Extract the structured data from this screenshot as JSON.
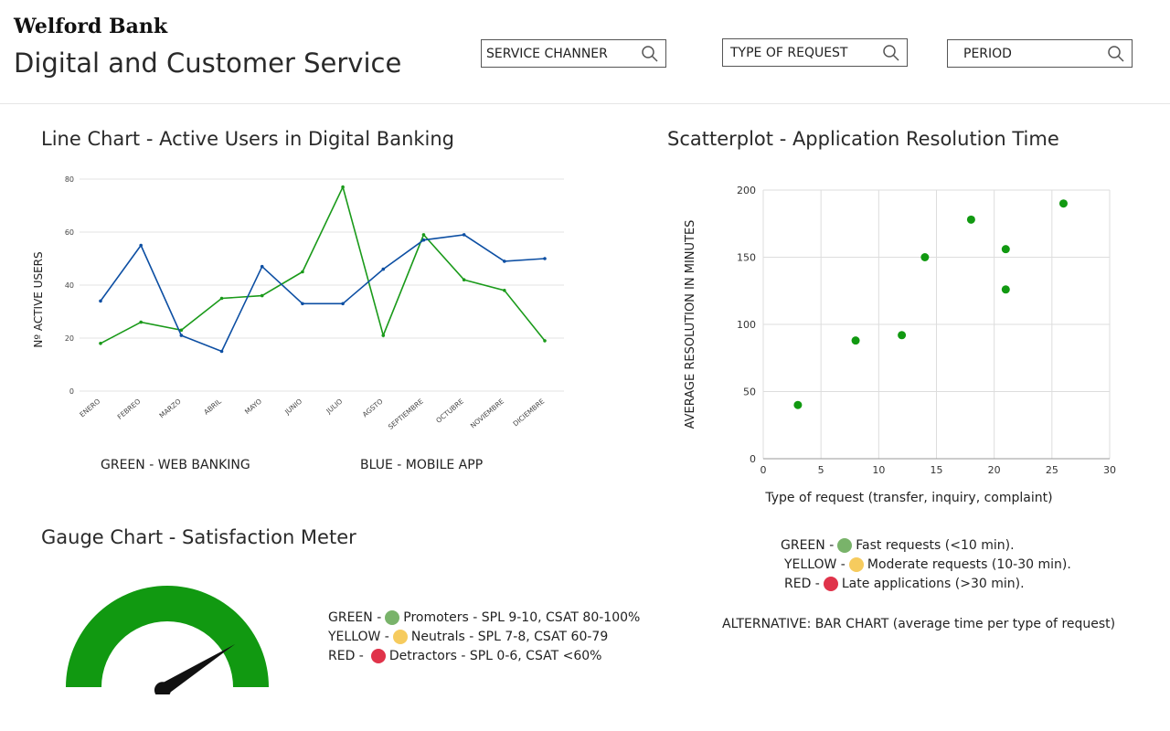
{
  "header": {
    "brand": "Welford Bank",
    "title": "Digital and Customer Service",
    "filters": [
      {
        "label": "SERVICE CHANNER",
        "icon": "search-icon"
      },
      {
        "label": "TYPE OF REQUEST",
        "icon": "search-icon"
      },
      {
        "label": "PERIOD",
        "icon": "search-icon"
      }
    ]
  },
  "line_section": {
    "title": "Line Chart - Active Users in Digital Banking",
    "legend_green": "GREEN - WEB BANKING",
    "legend_blue": "BLUE - MOBILE APP"
  },
  "scatter_section": {
    "title": "Scatterplot - Application Resolution Time",
    "legend": [
      {
        "prefix": "GREEN - ",
        "text": "Fast requests (<10 min).",
        "color": "#79b36a"
      },
      {
        "prefix": "YELLOW - ",
        "text": "Moderate requests (10-30 min).",
        "color": "#f6cb5e"
      },
      {
        "prefix": "RED - ",
        "text": "Late applications (>30 min).",
        "color": "#e0334a"
      }
    ],
    "alternative_note": "ALTERNATIVE: BAR CHART (average time per type of request)"
  },
  "gauge_section": {
    "title": "Gauge Chart - Satisfaction Meter",
    "legend": [
      {
        "prefix": "GREEN - ",
        "text": "Promoters - SPL 9-10, CSAT 80-100%",
        "color": "#79b36a"
      },
      {
        "prefix": "YELLOW - ",
        "text": "Neutrals - SPL 7-8, CSAT 60-79",
        "color": "#f6cb5e"
      },
      {
        "prefix": "RED - ",
        "text": "Detractors - SPL 0-6, CSAT <60%",
        "color": "#e0334a"
      }
    ]
  },
  "colors": {
    "web_banking": "#1a9a1a",
    "mobile_app": "#0d4fa3",
    "scatter_point": "#119911",
    "gauge_fill": "#119911",
    "needle": "#111111"
  },
  "chart_data": [
    {
      "type": "line",
      "categories": [
        "ENERO",
        "FEBREO",
        "MARZO",
        "ABRIL",
        "MAYO",
        "JUNIO",
        "JULIO",
        "AGSTO",
        "SEPTIEMBRE",
        "OCTUBRE",
        "NOVIEMBRE",
        "DICIEMBRE"
      ],
      "series": [
        {
          "name": "WEB BANKING",
          "color": "#1a9a1a",
          "values": [
            18,
            26,
            23,
            35,
            36,
            45,
            77,
            21,
            59,
            42,
            38,
            19
          ]
        },
        {
          "name": "MOBILE APP",
          "color": "#0d4fa3",
          "values": [
            34,
            55,
            21,
            15,
            47,
            33,
            33,
            46,
            57,
            59,
            49,
            50
          ]
        }
      ],
      "ylabel": "Nº ACTIVE USERS",
      "ylim": [
        0,
        80
      ],
      "yticks": [
        0,
        20,
        40,
        60,
        80
      ],
      "grid": true
    },
    {
      "type": "scatter",
      "x": [
        3,
        8,
        12,
        14,
        18,
        21,
        21,
        26
      ],
      "y": [
        40,
        88,
        92,
        150,
        178,
        156,
        126,
        190
      ],
      "xlabel": "Type of request (transfer, inquiry, complaint)",
      "ylabel": "AVERAGE RESOLUTION IN MINUTES",
      "xlim": [
        0,
        30
      ],
      "ylim": [
        0,
        200
      ],
      "xticks": [
        0,
        5,
        10,
        15,
        20,
        25,
        30
      ],
      "yticks": [
        0,
        50,
        100,
        150,
        200
      ],
      "grid": true
    },
    {
      "type": "gauge",
      "value": 0.82,
      "range": [
        0,
        1
      ]
    }
  ]
}
